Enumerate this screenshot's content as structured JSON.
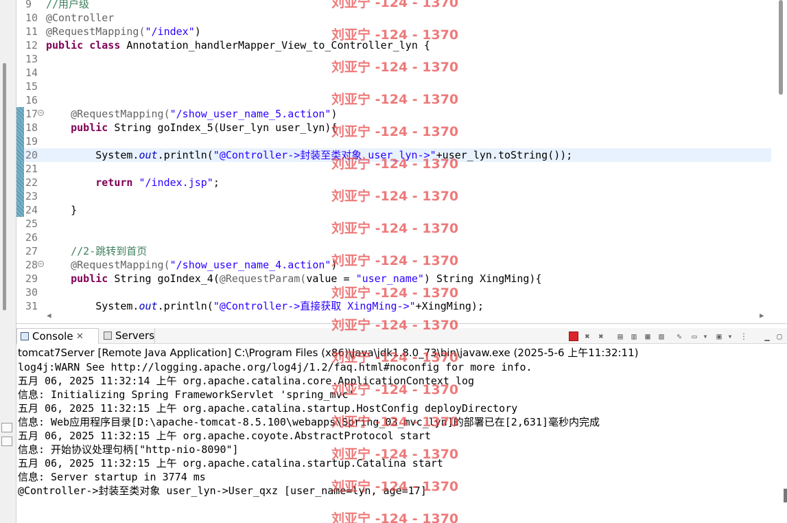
{
  "editor": {
    "lines": [
      {
        "n": "9",
        "tokens": [
          {
            "t": "//用户级",
            "c": "cmt"
          }
        ]
      },
      {
        "n": "10",
        "tokens": [
          {
            "t": "@Controller",
            "c": "ann"
          }
        ]
      },
      {
        "n": "11",
        "tokens": [
          {
            "t": "@RequestMapping(",
            "c": "ann"
          },
          {
            "t": "\"/index\"",
            "c": "str"
          },
          {
            "t": ")",
            "c": ""
          }
        ]
      },
      {
        "n": "12",
        "tokens": [
          {
            "t": "public",
            "c": "kw"
          },
          {
            "t": " ",
            "c": ""
          },
          {
            "t": "class",
            "c": "kw"
          },
          {
            "t": " Annotation_handlerMapper_View_to_Controller_lyn {",
            "c": ""
          }
        ]
      },
      {
        "n": "13",
        "tokens": []
      },
      {
        "n": "14",
        "tokens": []
      },
      {
        "n": "15",
        "tokens": []
      },
      {
        "n": "16",
        "tokens": []
      },
      {
        "n": "17",
        "fold": true,
        "tokens": [
          {
            "t": "    ",
            "c": ""
          },
          {
            "t": "@RequestMapping(",
            "c": "ann"
          },
          {
            "t": "\"/show_user_name_5.action\"",
            "c": "str"
          },
          {
            "t": ")",
            "c": ""
          }
        ]
      },
      {
        "n": "18",
        "tokens": [
          {
            "t": "    ",
            "c": ""
          },
          {
            "t": "public",
            "c": "kw"
          },
          {
            "t": " String goIndex_5(User_lyn user_lyn){",
            "c": ""
          }
        ]
      },
      {
        "n": "19",
        "tokens": []
      },
      {
        "n": "20",
        "highlight": true,
        "tokens": [
          {
            "t": "        System.",
            "c": ""
          },
          {
            "t": "out",
            "c": "fld"
          },
          {
            "t": ".println(",
            "c": ""
          },
          {
            "t": "\"@Controller->封装至类对象 user_lyn->\"",
            "c": "str"
          },
          {
            "t": "+user_lyn.toString());",
            "c": ""
          }
        ]
      },
      {
        "n": "21",
        "tokens": []
      },
      {
        "n": "22",
        "tokens": [
          {
            "t": "        ",
            "c": ""
          },
          {
            "t": "return",
            "c": "kw"
          },
          {
            "t": " ",
            "c": ""
          },
          {
            "t": "\"/index.jsp\"",
            "c": "str"
          },
          {
            "t": ";",
            "c": ""
          }
        ]
      },
      {
        "n": "23",
        "tokens": []
      },
      {
        "n": "24",
        "tokens": [
          {
            "t": "    }",
            "c": ""
          }
        ]
      },
      {
        "n": "25",
        "tokens": []
      },
      {
        "n": "26",
        "tokens": []
      },
      {
        "n": "27",
        "tokens": [
          {
            "t": "    ",
            "c": ""
          },
          {
            "t": "//2-跳转到首页",
            "c": "cmt"
          }
        ]
      },
      {
        "n": "28",
        "fold": true,
        "tokens": [
          {
            "t": "    ",
            "c": ""
          },
          {
            "t": "@RequestMapping(",
            "c": "ann"
          },
          {
            "t": "\"/show_user_name_4.action\"",
            "c": "str"
          },
          {
            "t": ")",
            "c": ""
          }
        ]
      },
      {
        "n": "29",
        "tokens": [
          {
            "t": "    ",
            "c": ""
          },
          {
            "t": "public",
            "c": "kw"
          },
          {
            "t": " String goIndex_4(",
            "c": ""
          },
          {
            "t": "@RequestParam(",
            "c": "ann"
          },
          {
            "t": "value = ",
            "c": ""
          },
          {
            "t": "\"user_name\"",
            "c": "str"
          },
          {
            "t": ") String XingMing){",
            "c": ""
          }
        ]
      },
      {
        "n": "30",
        "tokens": []
      },
      {
        "n": "31",
        "tokens": [
          {
            "t": "        System.",
            "c": ""
          },
          {
            "t": "out",
            "c": "fld"
          },
          {
            "t": ".println(",
            "c": ""
          },
          {
            "t": "\"@Controller->直接获取 XingMing->\"",
            "c": "str"
          },
          {
            "t": "+XingMing);",
            "c": ""
          }
        ]
      }
    ]
  },
  "console": {
    "tabs": {
      "console": "Console",
      "console_close": "✕",
      "servers": "Servers"
    },
    "title": "tomcat7Server [Remote Java Application] C:\\Program Files (x86)\\Java\\jdk1.8.0_73\\bin\\javaw.exe (2025-5-6 上午11:32:11)",
    "output": [
      "log4j:WARN See http://logging.apache.org/log4j/1.2/faq.html#noconfig for more info.",
      "五月 06, 2025 11:32:14 上午 org.apache.catalina.core.ApplicationContext log",
      "信息: Initializing Spring FrameworkServlet 'spring_mvc'",
      "五月 06, 2025 11:32:15 上午 org.apache.catalina.startup.HostConfig deployDirectory",
      "信息: Web应用程序目录[D:\\apache-tomcat-8.5.100\\webapps\\Spring_03_mvc_lyn]的部署已在[2,631]毫秒内完成",
      "五月 06, 2025 11:32:15 上午 org.apache.coyote.AbstractProtocol start",
      "信息: 开始协议处理句柄[\"http-nio-8090\"]",
      "五月 06, 2025 11:32:15 上午 org.apache.catalina.startup.Catalina start",
      "信息: Server startup in 3774 ms",
      "@Controller->封装至类对象 user_lyn->User_qxz [user_name=lyn, age=17]"
    ]
  },
  "watermark": {
    "text": "刘亚宁 -124 - 1370"
  },
  "colors": {
    "keyword": "#7f0055",
    "annotation": "#646464",
    "string": "#2a00ff",
    "comment": "#3f7f5f",
    "field": "#0000c0",
    "line_highlight": "#e8f2fe",
    "watermark": "#e64646"
  },
  "icons": [
    "console-icon",
    "servers-icon",
    "terminate-icon",
    "remove-launch-icon",
    "remove-all-icon",
    "clear-console-icon",
    "scroll-lock-icon",
    "word-wrap-icon",
    "pin-console-icon",
    "display-console-icon",
    "open-console-icon",
    "view-menu-icon",
    "minimize-icon",
    "maximize-icon"
  ]
}
